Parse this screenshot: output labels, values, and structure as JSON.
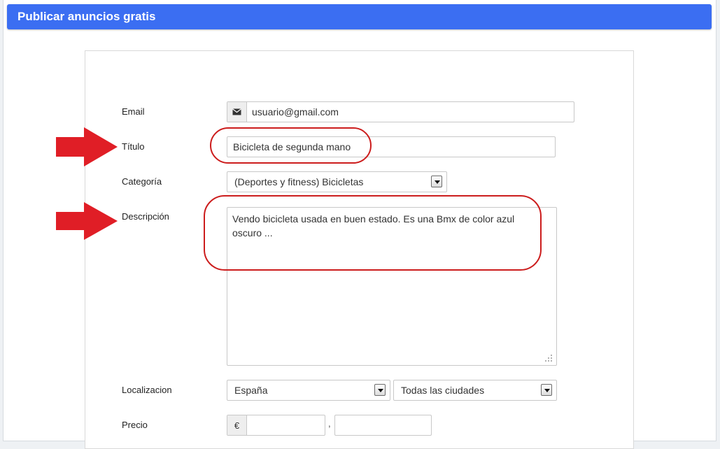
{
  "header": {
    "title": "Publicar anuncios gratis"
  },
  "form": {
    "email": {
      "label": "Email",
      "value": "usuario@gmail.com",
      "icon": "envelope-icon"
    },
    "titulo": {
      "label": "Título",
      "value": "Bicicleta de segunda mano"
    },
    "categoria": {
      "label": "Categoría",
      "selected": "(Deportes y fitness) Bicicletas"
    },
    "descripcion": {
      "label": "Descripción",
      "value": "Vendo bicicleta   usada en buen estado. Es una Bmx de color azul oscuro ..."
    },
    "localizacion": {
      "label": "Localizacion",
      "pais": "España",
      "ciudad": "Todas las ciudades"
    },
    "precio": {
      "label": "Precio",
      "currency": "€",
      "separator": ",",
      "entero": "",
      "decimales": ""
    }
  },
  "annotations": {
    "color": "#e01e26"
  },
  "colors": {
    "header_bg": "#3b6ef2"
  }
}
